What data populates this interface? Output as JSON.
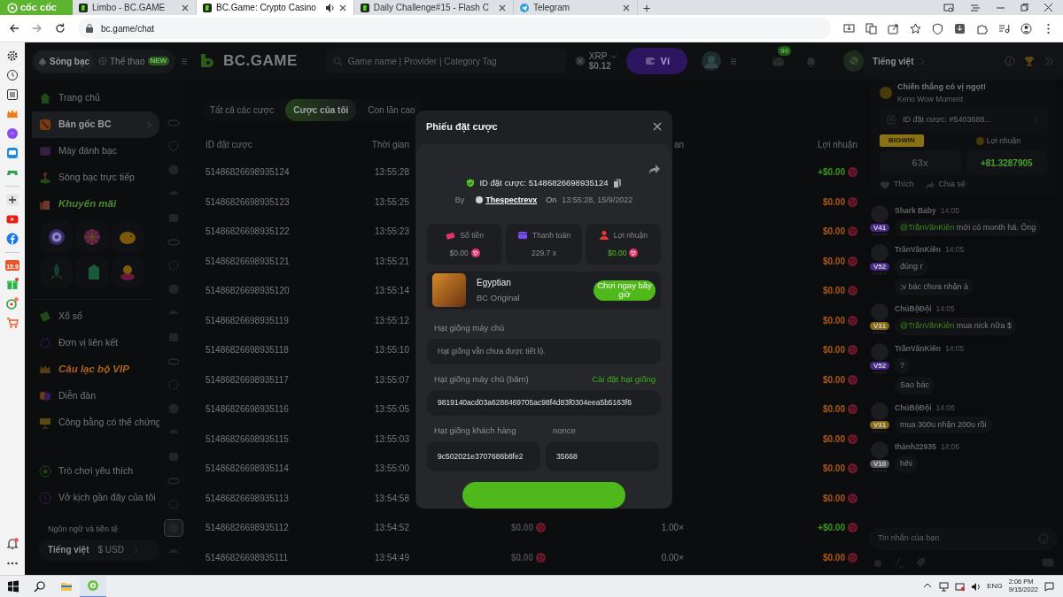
{
  "browser": {
    "brand": "cốc cốc",
    "tabs": [
      {
        "title": "Limbo - BC.GAME",
        "kind": "bc",
        "selected": false,
        "audio": false
      },
      {
        "title": "BC.Game: Crypto Casino",
        "kind": "bc",
        "selected": true,
        "audio": true
      },
      {
        "title": "Daily Challenge#15 - Flash C",
        "kind": "bc",
        "selected": false,
        "audio": false
      },
      {
        "title": "Telegram",
        "kind": "telegram",
        "selected": false,
        "audio": false
      }
    ],
    "new_tab": "+",
    "url": "bc.game/chat",
    "sidebar_badge": "15.9"
  },
  "header": {
    "sections": [
      {
        "label": "Sòng bạc",
        "selected": true
      },
      {
        "label": "Thể thao",
        "selected": false,
        "badge": "NEW"
      }
    ],
    "logo": "BC.GAME",
    "search_placeholder": "Game name | Provider | Category Tag",
    "currency": "XRP",
    "balance": "$0.12",
    "wallet": "Ví",
    "mail_badge": "99"
  },
  "nav": {
    "main": [
      {
        "label": "Trang chủ",
        "kind": "link",
        "selected": false,
        "submenu": false
      },
      {
        "label": "Bản gốc BC",
        "kind": "link",
        "selected": true,
        "submenu": true
      },
      {
        "label": "Máy đánh bạc",
        "kind": "link",
        "selected": false,
        "submenu": false
      },
      {
        "label": "Sòng bạc trực tiếp",
        "kind": "link",
        "selected": false,
        "submenu": false
      },
      {
        "label": "Khuyến mãi",
        "kind": "promo",
        "selected": false,
        "submenu": false
      }
    ],
    "more": [
      {
        "label": "Xổ số",
        "kind": "link",
        "selected": false,
        "submenu": false
      },
      {
        "label": "Đơn vị liên kết",
        "kind": "link",
        "selected": false,
        "submenu": false
      },
      {
        "label": "Câu lạc bộ VIP",
        "kind": "vip",
        "selected": false,
        "submenu": false
      },
      {
        "label": "Diễn đàn",
        "kind": "link",
        "selected": false,
        "submenu": false
      },
      {
        "label": "Công bằng có thể chứng",
        "kind": "link",
        "selected": false,
        "submenu": false
      }
    ],
    "personal": [
      {
        "label": "Trò chơi yêu thích",
        "selected": false,
        "submenu": false
      },
      {
        "label": "Vở kịch gần đây của tôi",
        "selected": false,
        "submenu": false
      }
    ],
    "language_label": "Ngôn ngữ và tiền tệ",
    "language": "Tiếng việt",
    "currency": "$ USD"
  },
  "rail": [
    {
      "selected": false
    },
    {
      "selected": false
    },
    {
      "selected": false
    },
    {
      "selected": false
    },
    {
      "selected": false
    },
    {
      "selected": false
    },
    {
      "selected": false
    },
    {
      "selected": false
    },
    {
      "selected": false
    },
    {
      "selected": false
    },
    {
      "selected": false
    },
    {
      "selected": false
    },
    {
      "selected": false
    },
    {
      "selected": false
    },
    {
      "selected": false
    },
    {
      "selected": false
    },
    {
      "selected": false
    },
    {
      "selected": true
    },
    {
      "selected": false
    }
  ],
  "bets": {
    "tabs": [
      {
        "label": "Tất cả các cược",
        "selected": false
      },
      {
        "label": "Cược của tôi",
        "selected": true
      },
      {
        "label": "Con lăn cao",
        "selected": false
      }
    ],
    "columns": {
      "id": "ID đặt cược",
      "time": "Thời gian",
      "payout": "an",
      "profit": "Lợi nhuận"
    },
    "rows": [
      {
        "id": "51486826698935124",
        "time": "13:55:28",
        "profit": "+$0.00",
        "positive": true
      },
      {
        "id": "51486826698935123",
        "time": "13:55:25",
        "profit": "$0.00",
        "positive": false
      },
      {
        "id": "51486826698935122",
        "time": "13:55:23",
        "profit": "$0.00",
        "positive": false
      },
      {
        "id": "51486826698935121",
        "time": "13:55:21",
        "profit": "$0.00",
        "positive": false
      },
      {
        "id": "51486826698935120",
        "time": "13:55:14",
        "profit": "$0.00",
        "positive": false
      },
      {
        "id": "51486826698935119",
        "time": "13:55:12",
        "profit": "$0.00",
        "positive": false
      },
      {
        "id": "51486826698935118",
        "time": "13:55:10",
        "profit": "$0.00",
        "positive": false
      },
      {
        "id": "51486826698935117",
        "time": "13:55:07",
        "profit": "$0.00",
        "positive": false
      },
      {
        "id": "51486826698935116",
        "time": "13:55:05",
        "profit": "$0.00",
        "positive": false
      },
      {
        "id": "51486826698935115",
        "time": "13:55:03",
        "profit": "$0.00",
        "positive": false
      },
      {
        "id": "51486826698935114",
        "time": "13:55:00",
        "profit": "$0.00",
        "positive": false
      },
      {
        "id": "51486826698935113",
        "time": "13:54:58",
        "profit": "$0.00",
        "positive": false
      },
      {
        "id": "51486826698935112",
        "time": "13:54:52",
        "bet": "$0.00",
        "payout": "1.00×",
        "profit": "+$0.00",
        "positive": true
      },
      {
        "id": "51486826698935111",
        "time": "13:54:49",
        "bet": "$0.00",
        "payout": "0.00×",
        "profit": "$0.00",
        "positive": false
      }
    ]
  },
  "modal": {
    "title": "Phiếu đặt cược",
    "bet_id": "ID đặt cược: 51486826698935124",
    "by": "By",
    "user": "Thespectrevx",
    "on": "On",
    "date": "13:55:28, 15/9/2022",
    "stats": [
      {
        "label": "Số tiền",
        "value": "$0.00",
        "kind": "amount"
      },
      {
        "label": "Thanh toán",
        "value": "229.7 x",
        "kind": "payout"
      },
      {
        "label": "Lợi nhuận",
        "value": "$0.00",
        "kind": "profit"
      }
    ],
    "game": {
      "name": "Egyptian",
      "provider": "BC Original",
      "play": "Chơi ngay bây giờ"
    },
    "server_seed": {
      "label": "Hạt giống máy chủ",
      "placeholder": "Hạt giống vẫn chưa được tiết lộ."
    },
    "hashed": {
      "label": "Hạt giống máy chủ (băm)",
      "link": "Cài đặt hạt giống",
      "value": "9819140acd03a6288469705ac98f4d83f0304eea5b5163f6"
    },
    "client": {
      "label": "Hạt giống khách hàng",
      "value": "9c502021e3707686b8fe2"
    },
    "nonce": {
      "label": "nonce",
      "value": "35668"
    }
  },
  "chat": {
    "language": "Tiếng việt",
    "card": {
      "title": "Chiến thắng có vị ngọt!",
      "subtitle": "Keno Wow Moment",
      "bet_id": "ID đặt cược: #5403688...",
      "ribbon": "BIGWIN",
      "profit_label": "Lợi nhuận",
      "multiplier": "63x",
      "profit": "+81.3287905",
      "like": "Thích",
      "share": "Chia sẻ"
    },
    "messages": [
      {
        "user": "Shark Baby",
        "time": "14:05",
        "vip": "V41",
        "color": "#4a2a86",
        "bubbles": [
          {
            "mention": "@TrầnVănKiên",
            "text": "mới có month hả. Ông"
          }
        ]
      },
      {
        "user": "TrầnVănKiên",
        "time": "14:05",
        "vip": "V52",
        "color": "#4a2a86",
        "bubbles": [
          {
            "text": "đúng r"
          },
          {
            "text": ";v bác chưa nhận à"
          }
        ]
      },
      {
        "user": "ChúBộĐội",
        "time": "14:05",
        "vip": "V31",
        "color": "#8a6a10",
        "bubbles": [
          {
            "mention": "@TrầnVănKiên",
            "text": "mua nick nữa $"
          }
        ]
      },
      {
        "user": "TrầnVănKiên",
        "time": "14:05",
        "vip": "V52",
        "color": "#4a2a86",
        "bubbles": [
          {
            "text": "?"
          },
          {
            "text": "Sao bác"
          }
        ]
      },
      {
        "user": "ChúBộĐội",
        "time": "14:06",
        "vip": "V31",
        "color": "#8a6a10",
        "bubbles": [
          {
            "text": "mua 300u nhận 200u rồi"
          }
        ]
      },
      {
        "user": "thành22935",
        "time": "14:06",
        "vip": "V10",
        "color": "#5a5c60",
        "bubbles": [
          {
            "text": "hihi"
          }
        ]
      }
    ],
    "input_placeholder": "Tin nhắn của bạn"
  },
  "taskbar": {
    "lang": "ENG",
    "time": "2:06 PM",
    "date": "9/15/2022"
  }
}
